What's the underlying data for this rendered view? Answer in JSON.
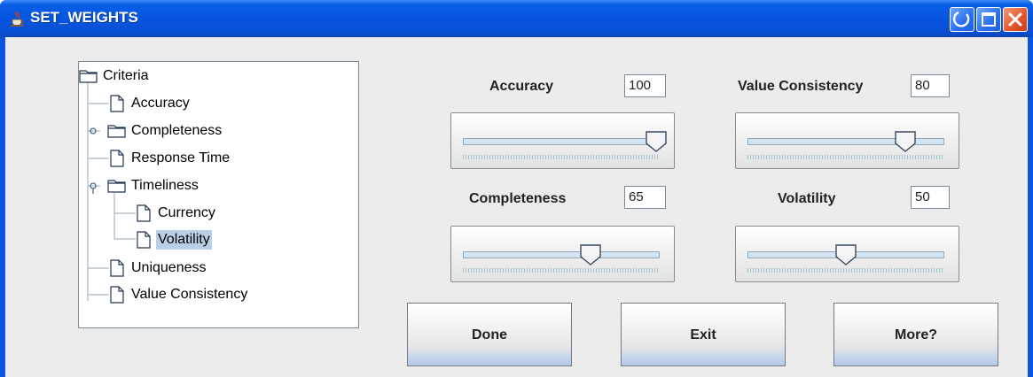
{
  "window": {
    "title": "SET_WEIGHTS",
    "icons": {
      "app": "java-cup-icon",
      "minimize": "minimize-icon",
      "maximize": "maximize-icon",
      "close": "close-icon"
    }
  },
  "tree": {
    "root": "Criteria",
    "items": [
      {
        "label": "Accuracy",
        "kind": "leaf"
      },
      {
        "label": "Completeness",
        "kind": "folder",
        "expanded": false
      },
      {
        "label": "Response Time",
        "kind": "leaf"
      },
      {
        "label": "Timeliness",
        "kind": "folder",
        "expanded": true
      },
      {
        "label": "Currency",
        "kind": "leaf"
      },
      {
        "label": "Volatility",
        "kind": "leaf",
        "selected": true
      },
      {
        "label": "Uniqueness",
        "kind": "leaf"
      },
      {
        "label": "Value Consistency",
        "kind": "leaf"
      }
    ]
  },
  "weights": [
    {
      "label": "Accuracy",
      "value": "100",
      "slider_fraction": 1.0
    },
    {
      "label": "Value Consistency",
      "value": "80",
      "slider_fraction": 0.8
    },
    {
      "label": "Completeness",
      "value": "65",
      "slider_fraction": 0.65
    },
    {
      "label": "Volatility",
      "value": "50",
      "slider_fraction": 0.5
    }
  ],
  "buttons": {
    "done": "Done",
    "exit": "Exit",
    "more": "More?"
  },
  "colors": {
    "titlebar": "#0753df",
    "close": "#e2552b",
    "selection": "#b8cfe5",
    "track": "#d6e4f2"
  }
}
